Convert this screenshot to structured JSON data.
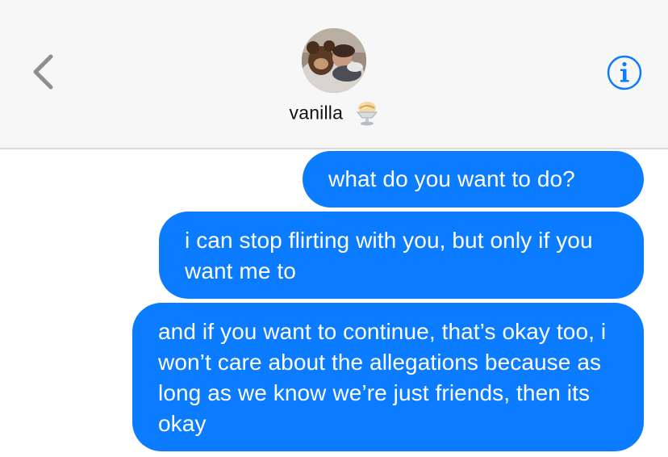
{
  "header": {
    "contact_name": "vanilla",
    "contact_emoji": "ice-cream-icon",
    "back_icon": "chevron-left-icon",
    "info_icon": "info-icon",
    "avatar": "contact-avatar"
  },
  "colors": {
    "header_bg": "#f7f7f7",
    "bubble_bg": "#0b7cff",
    "bubble_text": "#ffffff",
    "accent": "#0b7cff",
    "back_chevron": "#8e8e93"
  },
  "messages": [
    {
      "sender": "me",
      "text": "what do you want to do?"
    },
    {
      "sender": "me",
      "text": "i can stop flirting with you, but only if you want me to"
    },
    {
      "sender": "me",
      "text": "and if you want to continue, that’s okay too, i won’t care about the allegations because as long as we know we’re just friends, then its okay"
    }
  ]
}
